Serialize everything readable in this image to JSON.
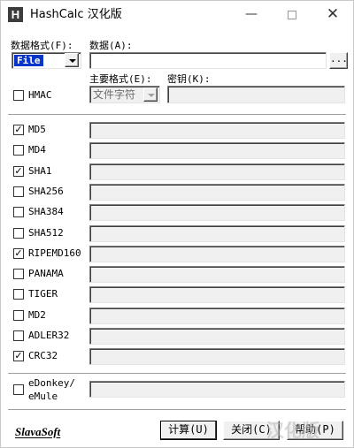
{
  "window": {
    "icon_letter": "H",
    "title": "HashCalc 汉化版",
    "minimize_glyph": "—",
    "close_glyph": "✕"
  },
  "format": {
    "label": "数据格式(F):",
    "value": "File"
  },
  "data": {
    "label": "数据(A):",
    "value": "",
    "browse_label": "..."
  },
  "hmac": {
    "label": "HMAC",
    "checked": false,
    "key_format_label": "主要格式(E):",
    "key_format_value": "文件字符",
    "key_label": "密钥(K):",
    "key_value": ""
  },
  "algorithms": [
    {
      "label": "MD5",
      "checked": true,
      "mark": "✓",
      "value": ""
    },
    {
      "label": "MD4",
      "checked": false,
      "mark": "",
      "value": ""
    },
    {
      "label": "SHA1",
      "checked": true,
      "mark": "✓",
      "value": ""
    },
    {
      "label": "SHA256",
      "checked": false,
      "mark": "",
      "value": ""
    },
    {
      "label": "SHA384",
      "checked": false,
      "mark": "",
      "value": ""
    },
    {
      "label": "SHA512",
      "checked": false,
      "mark": "",
      "value": ""
    },
    {
      "label": "RIPEMD160",
      "checked": true,
      "mark": "✓",
      "value": ""
    },
    {
      "label": "PANAMA",
      "checked": false,
      "mark": "",
      "value": ""
    },
    {
      "label": "TIGER",
      "checked": false,
      "mark": "",
      "value": ""
    },
    {
      "label": "MD2",
      "checked": false,
      "mark": "",
      "value": ""
    },
    {
      "label": "ADLER32",
      "checked": false,
      "mark": "",
      "value": ""
    },
    {
      "label": "CRC32",
      "checked": true,
      "mark": "✓",
      "value": ""
    }
  ],
  "edonkey": {
    "label_line1": "eDonkey/",
    "label_line2": "eMule",
    "checked": false,
    "value": ""
  },
  "footer": {
    "logo": "SlavaSoft",
    "calculate_label": "计算(U)",
    "close_label": "关闭(C)",
    "help_label": "帮助(P)"
  },
  "watermark": "汉化版"
}
